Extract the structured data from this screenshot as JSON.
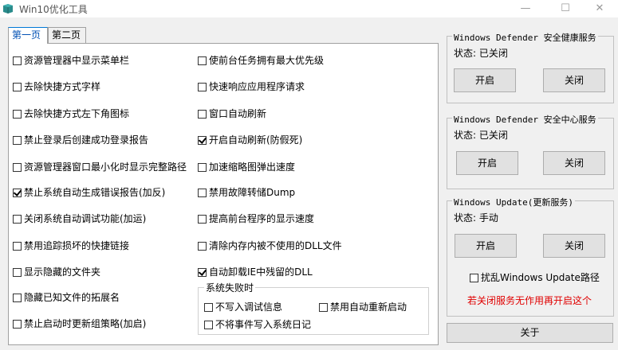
{
  "window": {
    "title": "Win10优化工具",
    "minimize": "—",
    "maximize": "☐",
    "close": "✕"
  },
  "tabs": [
    {
      "label": "第一页",
      "active": true
    },
    {
      "label": "第二页",
      "active": false
    }
  ],
  "left_column": [
    {
      "label": "资源管理器中显示菜单栏",
      "checked": false
    },
    {
      "label": "去除快捷方式字样",
      "checked": false
    },
    {
      "label": "去除快捷方式左下角图标",
      "checked": false
    },
    {
      "label": "禁止登录后创建成功登录报告",
      "checked": false
    },
    {
      "label": "资源管理器窗口最小化时显示完整路径",
      "checked": false
    },
    {
      "label": "禁止系统自动生成错误报告(加反)",
      "checked": true
    },
    {
      "label": "关闭系统自动调试功能(加运)",
      "checked": false
    },
    {
      "label": "禁用追踪损坏的快捷链接",
      "checked": false
    },
    {
      "label": "显示隐藏的文件夹",
      "checked": false
    },
    {
      "label": "隐藏已知文件的拓展名",
      "checked": false
    },
    {
      "label": "禁止启动时更新组策略(加启)",
      "checked": false
    }
  ],
  "right_column": [
    {
      "label": "使前台任务拥有最大优先级",
      "checked": false
    },
    {
      "label": "快速响应应用程序请求",
      "checked": false
    },
    {
      "label": "窗口自动刷新",
      "checked": false
    },
    {
      "label": "开启自动刷新(防假死)",
      "checked": true
    },
    {
      "label": "加速缩略图弹出速度",
      "checked": false
    },
    {
      "label": "禁用故障转储Dump",
      "checked": false
    },
    {
      "label": "提高前台程序的显示速度",
      "checked": false
    },
    {
      "label": "清除内存内被不使用的DLL文件",
      "checked": false
    },
    {
      "label": "自动卸载IE中残留的DLL",
      "checked": true
    }
  ],
  "failure_group": {
    "title": "系统失败时",
    "options": [
      {
        "label": "不写入调试信息",
        "checked": false
      },
      {
        "label": "禁用自动重新启动",
        "checked": false
      },
      {
        "label": "不将事件写入系统日记",
        "checked": false
      }
    ]
  },
  "services": [
    {
      "title": "Windows Defender 安全健康服务",
      "status": "状态: 已关闭",
      "start": "开启",
      "stop": "关闭"
    },
    {
      "title": "Windows Defender 安全中心服务",
      "status": "状态: 已关闭",
      "start": "开启",
      "stop": "关闭"
    },
    {
      "title": "Windows Update(更新服务)",
      "status": "状态: 手动",
      "start": "开启",
      "stop": "关闭"
    }
  ],
  "update_path_option": {
    "label": "扰乱Windows Update路径",
    "checked": false
  },
  "warning": "若关闭服务无作用再开启这个",
  "about_button": "关于",
  "colors": {
    "warning": "#e00000",
    "tab_active": "#0050b4",
    "app_icon": "#2a8c8c"
  }
}
